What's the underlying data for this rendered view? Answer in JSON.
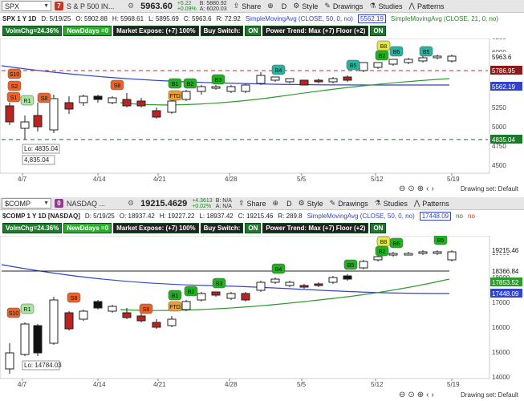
{
  "spx": {
    "symbol": "SPX",
    "badge": "7",
    "name": "S & P 500 IN...",
    "price": "5963.60",
    "change": "+5.22",
    "change_pct": "+0.09%",
    "bid": "B: 5880.92",
    "ask": "A: 6020.03",
    "header": "SPX 1 Y 1D",
    "date": "D: 5/19/25",
    "open": "O: 5902.88",
    "high": "H: 5968.61",
    "low": "L: 5895.69",
    "close": "C: 5963.6",
    "r": "R: 72.92",
    "sma1": "SimpleMovingAvg (CLOSE, 50, 0, no)",
    "sma1_val": "5562.19",
    "sma2": "SimpleMovingAvg (CLOSE, 21, 0, no)",
    "price_tags": [
      "5963.6",
      "5786.95",
      "5562.19",
      "4835.04"
    ],
    "yaxis": [
      "6250",
      "6000",
      "5750",
      "5500",
      "5250",
      "5000",
      "4750",
      "4500"
    ],
    "lo_label": "Lo: 4835.04",
    "lo_value": "4,835.04"
  },
  "comp": {
    "symbol": "$COMP",
    "badge": "0",
    "name": "NASDAQ ...",
    "price": "19215.4629",
    "change": "+4.3613",
    "change_pct": "+0.02%",
    "bid": "B: N/A",
    "ask": "A: N/A",
    "header": "$COMP 1 Y 1D [NASDAQ]",
    "date": "D: 5/19/25",
    "open": "O: 18937.42",
    "high": "H: 19227.22",
    "low": "L: 18937.42",
    "close": "C: 19215.46",
    "r": "R: 289.8",
    "sma1": "SimpleMovingAvg (CLOSE, 50, 0, no)",
    "sma1_val": "17448.09",
    "no1": "no",
    "no2": "no",
    "price_tags": [
      "19215.46",
      "18366.84",
      "17853.52",
      "17448.09"
    ],
    "yaxis": [
      "19000",
      "18000",
      "17000",
      "16000",
      "15000",
      "14000"
    ],
    "lo_label": "Lo: 14784.03"
  },
  "status": {
    "volm": "VolmChg=24.36%",
    "newddays": "NewDdays =0",
    "market_expose": "Market Expose: (+7) 100%",
    "buy_switch": "Buy Switch:",
    "on1": "ON",
    "power_trend": "Power Trend: Max (+7) Floor (+2)",
    "on2": "ON"
  },
  "toolbar": {
    "share": "Share",
    "d": "D",
    "style": "Style",
    "drawings": "Drawings",
    "studies": "Studies",
    "patterns": "Patterns"
  },
  "xaxis": [
    "4/7",
    "4/14",
    "4/21",
    "4/28",
    "5/5",
    "5/12",
    "5/19"
  ],
  "drawing_set": "Drawing set: Default",
  "signals": [
    "S10",
    "S2",
    "S1",
    "R1",
    "S8",
    "S8",
    "B1",
    "B2",
    "FTD",
    "B3",
    "B4",
    "B5",
    "B8",
    "B2",
    "B6",
    "B5"
  ]
}
